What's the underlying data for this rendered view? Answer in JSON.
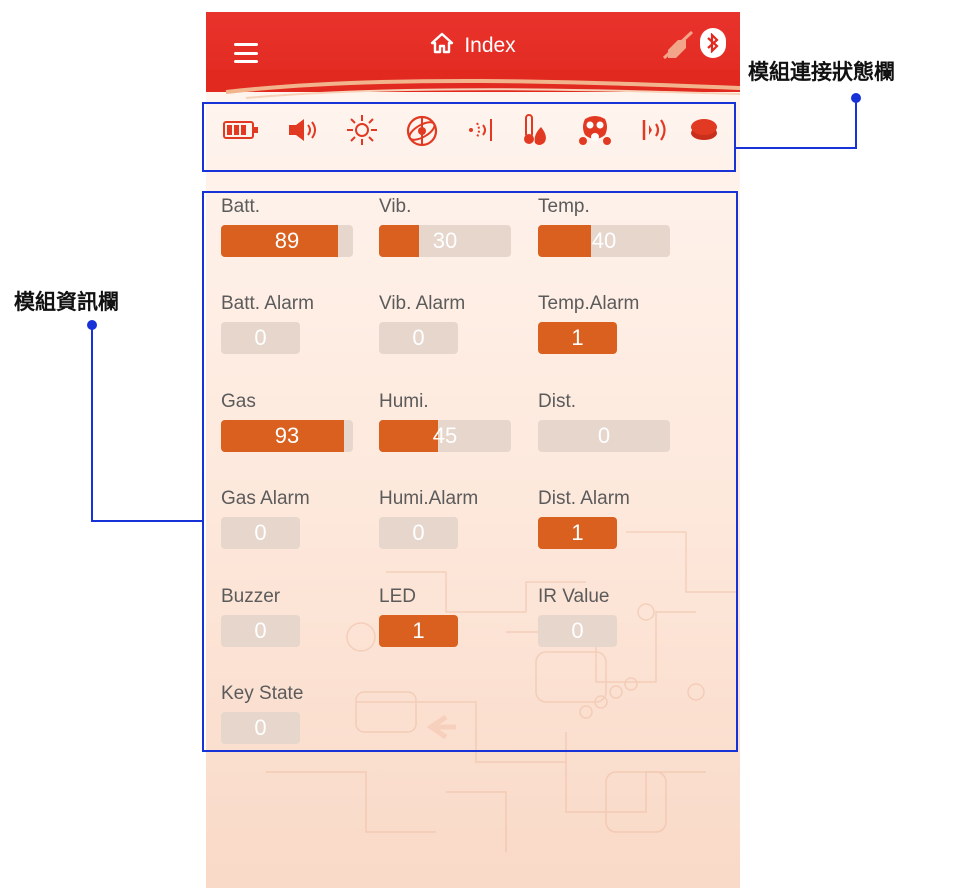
{
  "app": {
    "title": "Index",
    "icons": [
      "menu-icon",
      "home-icon",
      "plug-disconnected-icon",
      "bluetooth-icon"
    ]
  },
  "status_bar": {
    "icons": [
      "battery-icon",
      "speaker-icon",
      "light-icon",
      "gyro-icon",
      "vibration-icon",
      "temperature-icon",
      "gas-mask-icon",
      "sound-wave-icon",
      "button-icon"
    ]
  },
  "annotations": {
    "status_label": "模組連接狀態欄",
    "info_label": "模組資訊欄"
  },
  "modules": [
    {
      "label": "Batt.",
      "value": "89",
      "level": 0.89,
      "style": "wide"
    },
    {
      "label": "Vib.",
      "value": "30",
      "level": 0.3,
      "style": "wide"
    },
    {
      "label": "Temp.",
      "value": "40",
      "level": 0.4,
      "style": "wide"
    },
    {
      "label": "Batt. Alarm",
      "value": "0",
      "on": false
    },
    {
      "label": "Vib. Alarm",
      "value": "0",
      "on": false
    },
    {
      "label": "Temp.Alarm",
      "value": "1",
      "on": true
    },
    {
      "label": "Gas",
      "value": "93",
      "level": 0.93,
      "style": "wide"
    },
    {
      "label": "Humi.",
      "value": "45",
      "level": 0.45,
      "style": "wide"
    },
    {
      "label": "Dist.",
      "value": "0",
      "level": 0.0,
      "style": "wide"
    },
    {
      "label": "Gas Alarm",
      "value": "0",
      "on": false
    },
    {
      "label": "Humi.Alarm",
      "value": "0",
      "on": false
    },
    {
      "label": "Dist. Alarm",
      "value": "1",
      "on": true
    },
    {
      "label": "Buzzer",
      "value": "0",
      "on": false
    },
    {
      "label": "LED",
      "value": "1",
      "on": true
    },
    {
      "label": "IR Value",
      "value": "0",
      "on": false
    },
    {
      "label": "Key State",
      "value": "0",
      "on": false
    }
  ],
  "colors": {
    "appbar": "#e1291f",
    "fill": "#d9601e",
    "track": "#e6d6cc",
    "annotation_box": "#1732d6"
  }
}
